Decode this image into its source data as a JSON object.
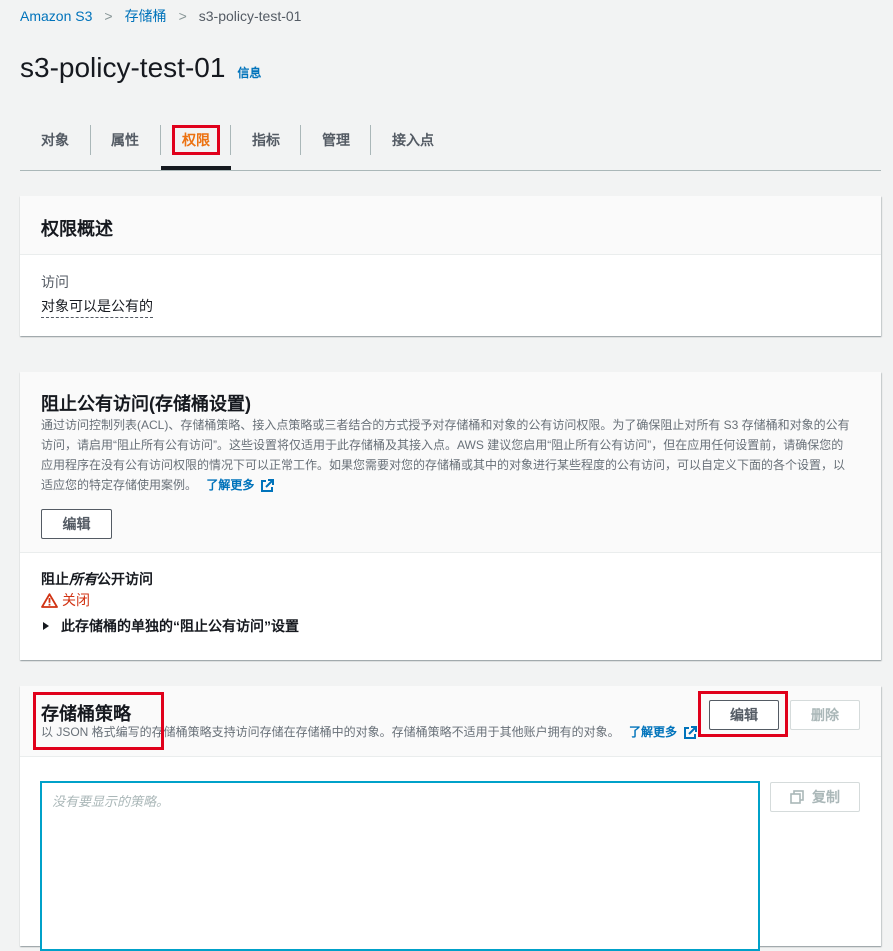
{
  "breadcrumb": {
    "root": "Amazon S3",
    "buckets": "存储桶",
    "current": "s3-policy-test-01"
  },
  "page": {
    "title": "s3-policy-test-01",
    "info_link": "信息"
  },
  "tabs": [
    "对象",
    "属性",
    "权限",
    "指标",
    "管理",
    "接入点"
  ],
  "active_tab": "权限",
  "overview": {
    "title": "权限概述",
    "access_label": "访问",
    "access_value": "对象可以是公有的"
  },
  "block_public": {
    "title": "阻止公有访问(存储桶设置)",
    "description": "通过访问控制列表(ACL)、存储桶策略、接入点策略或三者结合的方式授予对存储桶和对象的公有访问权限。为了确保阻止对所有 S3 存储桶和对象的公有访问，请启用“阻止所有公有访问”。这些设置将仅适用于此存储桶及其接入点。AWS 建议您启用“阻止所有公有访问”，但在应用任何设置前，请确保您的应用程序在没有公有访问权限的情况下可以正常工作。如果您需要对您的存储桶或其中的对象进行某些程度的公有访问，可以自定义下面的各个设置，以适应您的特定存储使用案例。",
    "learn_more": "了解更多",
    "edit_label": "编辑",
    "block_all_prefix": "阻止",
    "block_all_em": "所有",
    "block_all_suffix": "公开访问",
    "status": "关闭",
    "expander": "此存储桶的单独的“阻止公有访问”设置"
  },
  "policy": {
    "title": "存储桶策略",
    "description": "以 JSON 格式编写的存储桶策略支持访问存储在存储桶中的对象。存储桶策略不适用于其他账户拥有的对象。",
    "learn_more": "了解更多",
    "edit_label": "编辑",
    "delete_label": "删除",
    "copy_label": "复制",
    "placeholder": "没有要显示的策略。"
  },
  "colors": {
    "link": "#0073bb",
    "active_tab": "#ec7211",
    "warning": "#d13212",
    "highlight": "#e0001b"
  }
}
